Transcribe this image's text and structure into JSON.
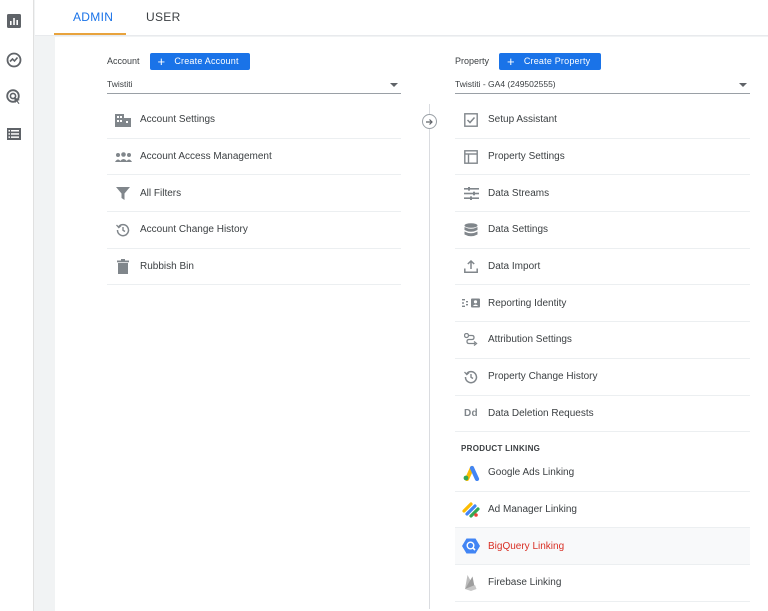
{
  "rail": {
    "icons": [
      "reports-icon",
      "explore-icon",
      "advertising-icon",
      "configure-icon"
    ]
  },
  "tabs": {
    "admin": "ADMIN",
    "user": "USER"
  },
  "account": {
    "label": "Account",
    "create_button": "Create Account",
    "selected": "Twistiti",
    "items": [
      {
        "label": "Account Settings",
        "icon": "building-icon"
      },
      {
        "label": "Account Access Management",
        "icon": "people-icon"
      },
      {
        "label": "All Filters",
        "icon": "filter-icon"
      },
      {
        "label": "Account Change History",
        "icon": "history-icon"
      },
      {
        "label": "Rubbish Bin",
        "icon": "trash-icon"
      }
    ]
  },
  "property": {
    "label": "Property",
    "create_button": "Create Property",
    "selected": "Twistiti - GA4 (249502555)",
    "items": [
      {
        "label": "Setup Assistant",
        "icon": "checklist-icon"
      },
      {
        "label": "Property Settings",
        "icon": "layout-icon"
      },
      {
        "label": "Data Streams",
        "icon": "streams-icon"
      },
      {
        "label": "Data Settings",
        "icon": "database-icon"
      },
      {
        "label": "Data Import",
        "icon": "upload-icon"
      },
      {
        "label": "Reporting Identity",
        "icon": "identity-icon"
      },
      {
        "label": "Attribution Settings",
        "icon": "attribution-icon"
      },
      {
        "label": "Property Change History",
        "icon": "history-icon"
      },
      {
        "label": "Data Deletion Requests",
        "icon": "deletion-dd-icon"
      }
    ],
    "product_linking_title": "PRODUCT LINKING",
    "linking": [
      {
        "label": "Google Ads Linking",
        "icon": "google-ads-icon"
      },
      {
        "label": "Ad Manager Linking",
        "icon": "ad-manager-icon"
      },
      {
        "label": "BigQuery Linking",
        "icon": "bigquery-icon"
      },
      {
        "label": "Firebase Linking",
        "icon": "firebase-icon"
      }
    ]
  },
  "colors": {
    "primary": "#1a73e8",
    "tab_underline": "#e8a33d",
    "highlight_text": "#d93025"
  }
}
